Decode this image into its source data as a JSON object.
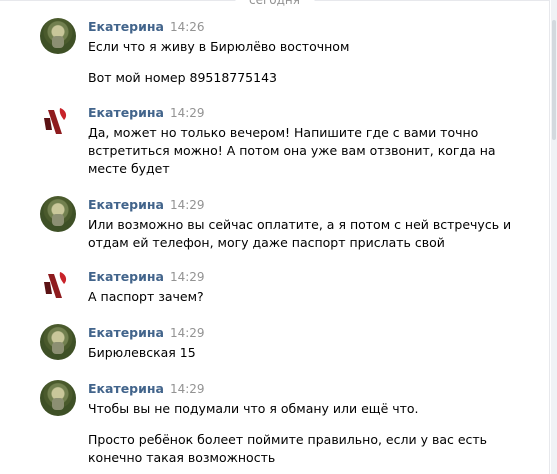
{
  "date_label": "сегодня",
  "messages": [
    {
      "author": "Екатерина",
      "time": "14:26",
      "avatar": "green-avatar",
      "paragraphs": [
        "Если что я живу в Бирюлёво восточном",
        "Вот мой номер 89518775143"
      ]
    },
    {
      "author": "Екатерина",
      "time": "14:29",
      "avatar": "red-white-avatar",
      "paragraphs": [
        "Да, может но только вечером! Напишите где с вами точно встретиться можно! А потом она уже вам отзвонит, когда на месте будет"
      ]
    },
    {
      "author": "Екатерина",
      "time": "14:29",
      "avatar": "green-avatar",
      "paragraphs": [
        "Или возможно вы сейчас оплатите, а я потом с ней встречусь и отдам ей телефон, могу даже паспорт прислать свой"
      ]
    },
    {
      "author": "Екатерина",
      "time": "14:29",
      "avatar": "red-white-avatar",
      "paragraphs": [
        "А паспорт зачем?"
      ]
    },
    {
      "author": "Екатерина",
      "time": "14:29",
      "avatar": "green-avatar",
      "paragraphs": [
        "Бирюлевская 15"
      ]
    },
    {
      "author": "Екатерина",
      "time": "14:29",
      "avatar": "green-avatar",
      "paragraphs": [
        "Чтобы вы не подумали что я обману или ещё что.",
        "Просто ребёнок болеет поймите правильно, если у вас есть конечно такая возможность"
      ]
    }
  ]
}
